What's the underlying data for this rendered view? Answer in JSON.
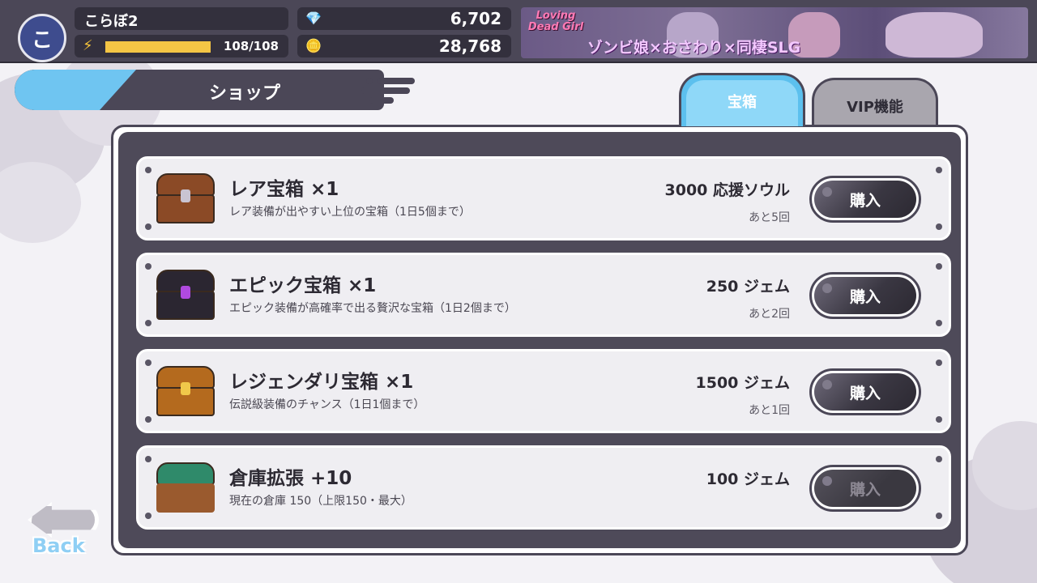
{
  "header": {
    "avatar_initial": "こ",
    "player_name": "こらぼ2",
    "stamina_text": "108/108",
    "stamina_level": 1.0,
    "gems": "6,702",
    "coins": "28,768"
  },
  "banner": {
    "logo_text": "Loving Dead Girl",
    "tagline": "ゾンビ娘×おさわり×同棲SLG"
  },
  "page": {
    "title": "ショップ"
  },
  "tabs": [
    {
      "label": "宝箱",
      "active": true
    },
    {
      "label": "VIP機能",
      "active": false
    }
  ],
  "items": [
    {
      "title": "レア宝箱 ×1",
      "description": "レア装備が出やすい上位の宝箱（1日5個まで）",
      "price": "3000 応援ソウル",
      "limit": "あと5回",
      "button": "購入",
      "chest_color": "#8b4a26",
      "disabled": false
    },
    {
      "title": "エピック宝箱 ×1",
      "description": "エピック装備が高確率で出る贅沢な宝箱（1日2個まで）",
      "price": "250 ジェム",
      "limit": "あと2回",
      "button": "購入",
      "chest_color": "#2b2631",
      "disabled": false
    },
    {
      "title": "レジェンダリ宝箱 ×1",
      "description": "伝説級装備のチャンス（1日1個まで）",
      "price": "1500 ジェム",
      "limit": "あと1回",
      "button": "購入",
      "chest_color": "#b46a1e",
      "disabled": false
    },
    {
      "title": "倉庫拡張 +10",
      "description": "現在の倉庫 150（上限150・最大）",
      "price": "100 ジェム",
      "limit": "",
      "button": "購入",
      "chest_color": "#2f8a6a",
      "disabled": true
    }
  ],
  "back": {
    "label": "Back"
  },
  "colors": {
    "accent": "#6fc5f1",
    "panel": "#4e4a59",
    "topbar": "#4b4757",
    "stamina": "#f4c545"
  },
  "icons": {
    "stamina": "lightning-icon",
    "gem": "gem-icon",
    "coin": "coin-icon"
  }
}
